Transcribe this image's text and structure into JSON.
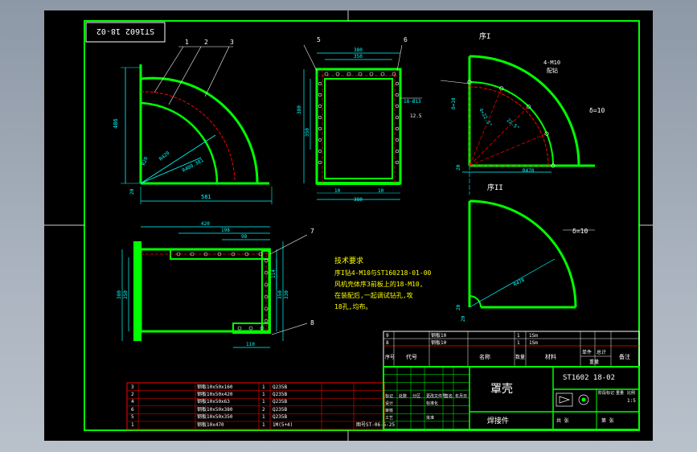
{
  "colors": {
    "background": "#000000",
    "frame": "#00ff00",
    "dimension": "#00ffff",
    "annotation": "#ffff00",
    "table_red": "#ff0000",
    "centerline": "#ff0000",
    "text_white": "#ffffff",
    "viewport": "#a8b1bc"
  },
  "stamp": "ST1602 18-02",
  "view_labels": {
    "a": "序I",
    "b": "序II"
  },
  "front_view": {
    "balloons": [
      "1",
      "2",
      "3"
    ],
    "dims": {
      "height": "486",
      "width": "581",
      "r1": "R400.381",
      "r2": "R420",
      "r3": "R20",
      "step": "20"
    }
  },
  "side_view": {
    "balloons": [
      "5",
      "6"
    ],
    "dims": {
      "top1": "380",
      "top2": "350",
      "d_hole": "18-Ø13",
      "depth": "12.5",
      "h1": "380",
      "h2": "350",
      "bot1": "10",
      "bot2": "10",
      "total": "380"
    }
  },
  "arc_view_a": {
    "notes": [
      "4-M10",
      "配钻",
      "δ=10"
    ],
    "dims": {
      "r": "R470",
      "a1": "4×22.5°",
      "a2": "22.5°",
      "s1": "δ=10",
      "s2": "20"
    }
  },
  "arc_view_b": {
    "notes": [
      "δ=10"
    ],
    "dims": {
      "r": "R478",
      "s1": "20",
      "s2": "20"
    }
  },
  "bottom_view": {
    "balloons": [
      "7",
      "8"
    ],
    "dims": {
      "top": "420",
      "d1": "198",
      "d2": "98",
      "h1": "380",
      "h2": "350",
      "h3": "114",
      "r1": "350",
      "r2": "330",
      "bot": "110"
    }
  },
  "tech_req": {
    "title": "技术要求",
    "lines": [
      "序I钻4-M10与ST160218-01-00",
      "风机壳体序3前板上的18-M10,",
      "在装配后,一起调试钻孔,攻",
      "18孔,均布。"
    ]
  },
  "parts_list_upper": {
    "rows": [
      {
        "no": "9",
        "name": "钢板10",
        "qty": "1",
        "spec": "1Sm"
      },
      {
        "no": "8",
        "name": "钢板10",
        "qty": "1",
        "spec": "1Sm"
      }
    ],
    "header": [
      "序号",
      "代号",
      "名称",
      "数量",
      "材料",
      "单件",
      "总计",
      "备注"
    ],
    "header_sub": "重量"
  },
  "parts_list_lower": {
    "rows": [
      {
        "no": "3",
        "name": "钢板10x50x160",
        "qty": "1",
        "mat": "Q235B"
      },
      {
        "no": "2",
        "name": "钢板10x50x420",
        "qty": "1",
        "mat": "Q235B"
      },
      {
        "no": "4",
        "name": "钢板10x50x63",
        "qty": "1",
        "mat": "Q235B"
      },
      {
        "no": "6",
        "name": "钢板10x50x380",
        "qty": "2",
        "mat": "Q235B"
      },
      {
        "no": "5",
        "name": "钢板10x50x350",
        "qty": "1",
        "mat": "Q235B"
      },
      {
        "no": "1",
        "name": "钢板10x470",
        "qty": "1",
        "mat": "1M(5+4)"
      }
    ],
    "footer": "图号ST-06-5-25"
  },
  "title_block": {
    "part_name": "罩壳",
    "drawing_no": "ST1602 18-02",
    "type": "焊接件",
    "labels": [
      "标记",
      "处数",
      "分区",
      "更改文件号",
      "签名",
      "年月日",
      "设计",
      "标准化",
      "审核",
      "工艺",
      "批准",
      "阶段标记",
      "重量",
      "比例"
    ],
    "scale": "1:5",
    "sheet": [
      "共 张",
      "第 张"
    ]
  }
}
